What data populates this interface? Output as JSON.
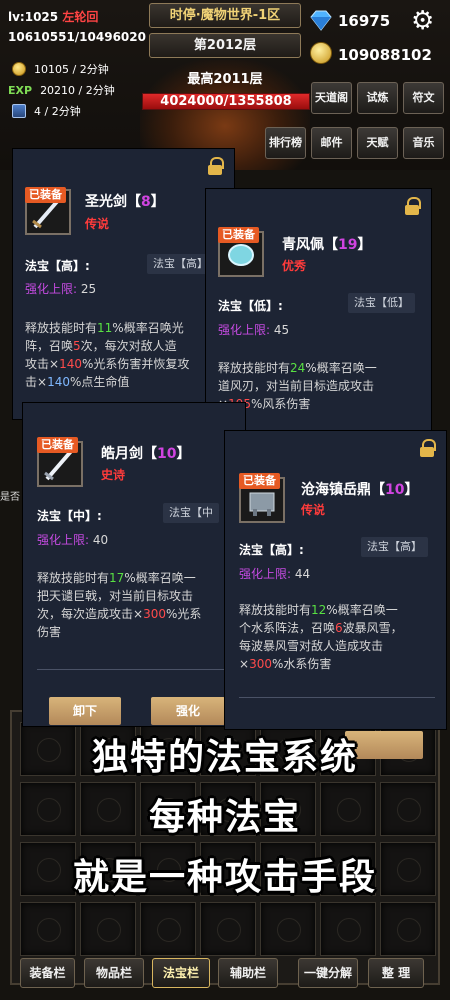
{
  "hud": {
    "level": "lv:1025",
    "title_name": "左轮回",
    "hp": "10610551/10496020",
    "gold_rate": "10105 / 2分钟",
    "exp_label": "EXP",
    "exp_rate": "20210 / 2分钟",
    "chest_rate": "4 / 2分钟",
    "game_title": "时停·魔物世界-1区",
    "floor": "第2012层",
    "best": "最高2011层",
    "boss_hp": "4024000/1355808",
    "boss_hp_fraction": 1.0,
    "gems": "16975",
    "gold": "109088102",
    "menu": [
      "天道阁",
      "试炼",
      "符文",
      "排行榜",
      "邮件",
      "天赋",
      "音乐"
    ]
  },
  "partial_texts": {
    "left_edge": "是否"
  },
  "cards": [
    {
      "equipped": "已装备",
      "name": "圣光剑【",
      "level": "8",
      "name_end": "】",
      "grade": "传说",
      "grade_color": "#ff3b3b",
      "type": "法宝【高】:",
      "type_chip": "法宝【高】",
      "enhance_label": "强化上限:",
      "enhance_value": "25",
      "desc": [
        {
          "t": "释放技能时有"
        },
        {
          "t": "11",
          "c": "g"
        },
        {
          "t": "%概率召唤光\n阵，召唤"
        },
        {
          "t": "5",
          "c": "r"
        },
        {
          "t": "次，每次对敌人造\n攻击×"
        },
        {
          "t": "140",
          "c": "r"
        },
        {
          "t": "%光系伤害并恢复攻\n击×"
        },
        {
          "t": "140",
          "c": "b"
        },
        {
          "t": "%点生命值"
        }
      ]
    },
    {
      "equipped": "已装备",
      "name": "青风佩【",
      "level": "19",
      "name_end": "】",
      "grade": "优秀",
      "grade_color": "#ff3b3b",
      "type": "法宝【低】:",
      "type_chip": "法宝【低】",
      "enhance_label": "强化上限:",
      "enhance_value": "45",
      "desc": [
        {
          "t": "释放技能时有"
        },
        {
          "t": "24",
          "c": "g"
        },
        {
          "t": "%概率召唤一\n道风刃，对当前目标造成攻击\n×"
        },
        {
          "t": "195",
          "c": "r"
        },
        {
          "t": "%风系伤害"
        }
      ]
    },
    {
      "equipped": "已装备",
      "name": "皓月剑【",
      "level": "10",
      "name_end": "】",
      "grade": "史诗",
      "grade_color": "#ff3b3b",
      "type": "法宝【中】:",
      "type_chip": "法宝【中",
      "enhance_label": "强化上限:",
      "enhance_value": "40",
      "desc": [
        {
          "t": "释放技能时有"
        },
        {
          "t": "17",
          "c": "g"
        },
        {
          "t": "%概率召唤一\n把天谴巨戟，对当前目标攻击\n次，每次造成攻击×"
        },
        {
          "t": "300",
          "c": "r"
        },
        {
          "t": "%光系\n伤害"
        }
      ],
      "btn_unequip": "卸下",
      "btn_enhance": "强化"
    },
    {
      "equipped": "已装备",
      "name": "沧海镇岳鼎【",
      "level": "10",
      "name_end": "】",
      "grade": "传说",
      "grade_color": "#ff3b3b",
      "type": "法宝【高】:",
      "type_chip": "法宝【高】",
      "enhance_label": "强化上限:",
      "enhance_value": "44",
      "desc": [
        {
          "t": "释放技能时有"
        },
        {
          "t": "12",
          "c": "g"
        },
        {
          "t": "%概率召唤一\n个水系阵法，召唤"
        },
        {
          "t": "6",
          "c": "r"
        },
        {
          "t": "波暴风雪，\n每波暴风雪对敌人造成攻击\n×"
        },
        {
          "t": "300",
          "c": "r"
        },
        {
          "t": "%水系伤害"
        }
      ]
    }
  ],
  "caption": [
    "独特的法宝系统",
    "每种法宝",
    "就是一种攻击手段"
  ],
  "tabs": [
    "装备栏",
    "物品栏",
    "法宝栏",
    "辅助栏",
    "一键分解",
    "整 理"
  ],
  "colors": {
    "card_bg": "#1d2434",
    "accent": "#e65a23",
    "level": "#d044e0",
    "enhance": "#c64be2"
  }
}
